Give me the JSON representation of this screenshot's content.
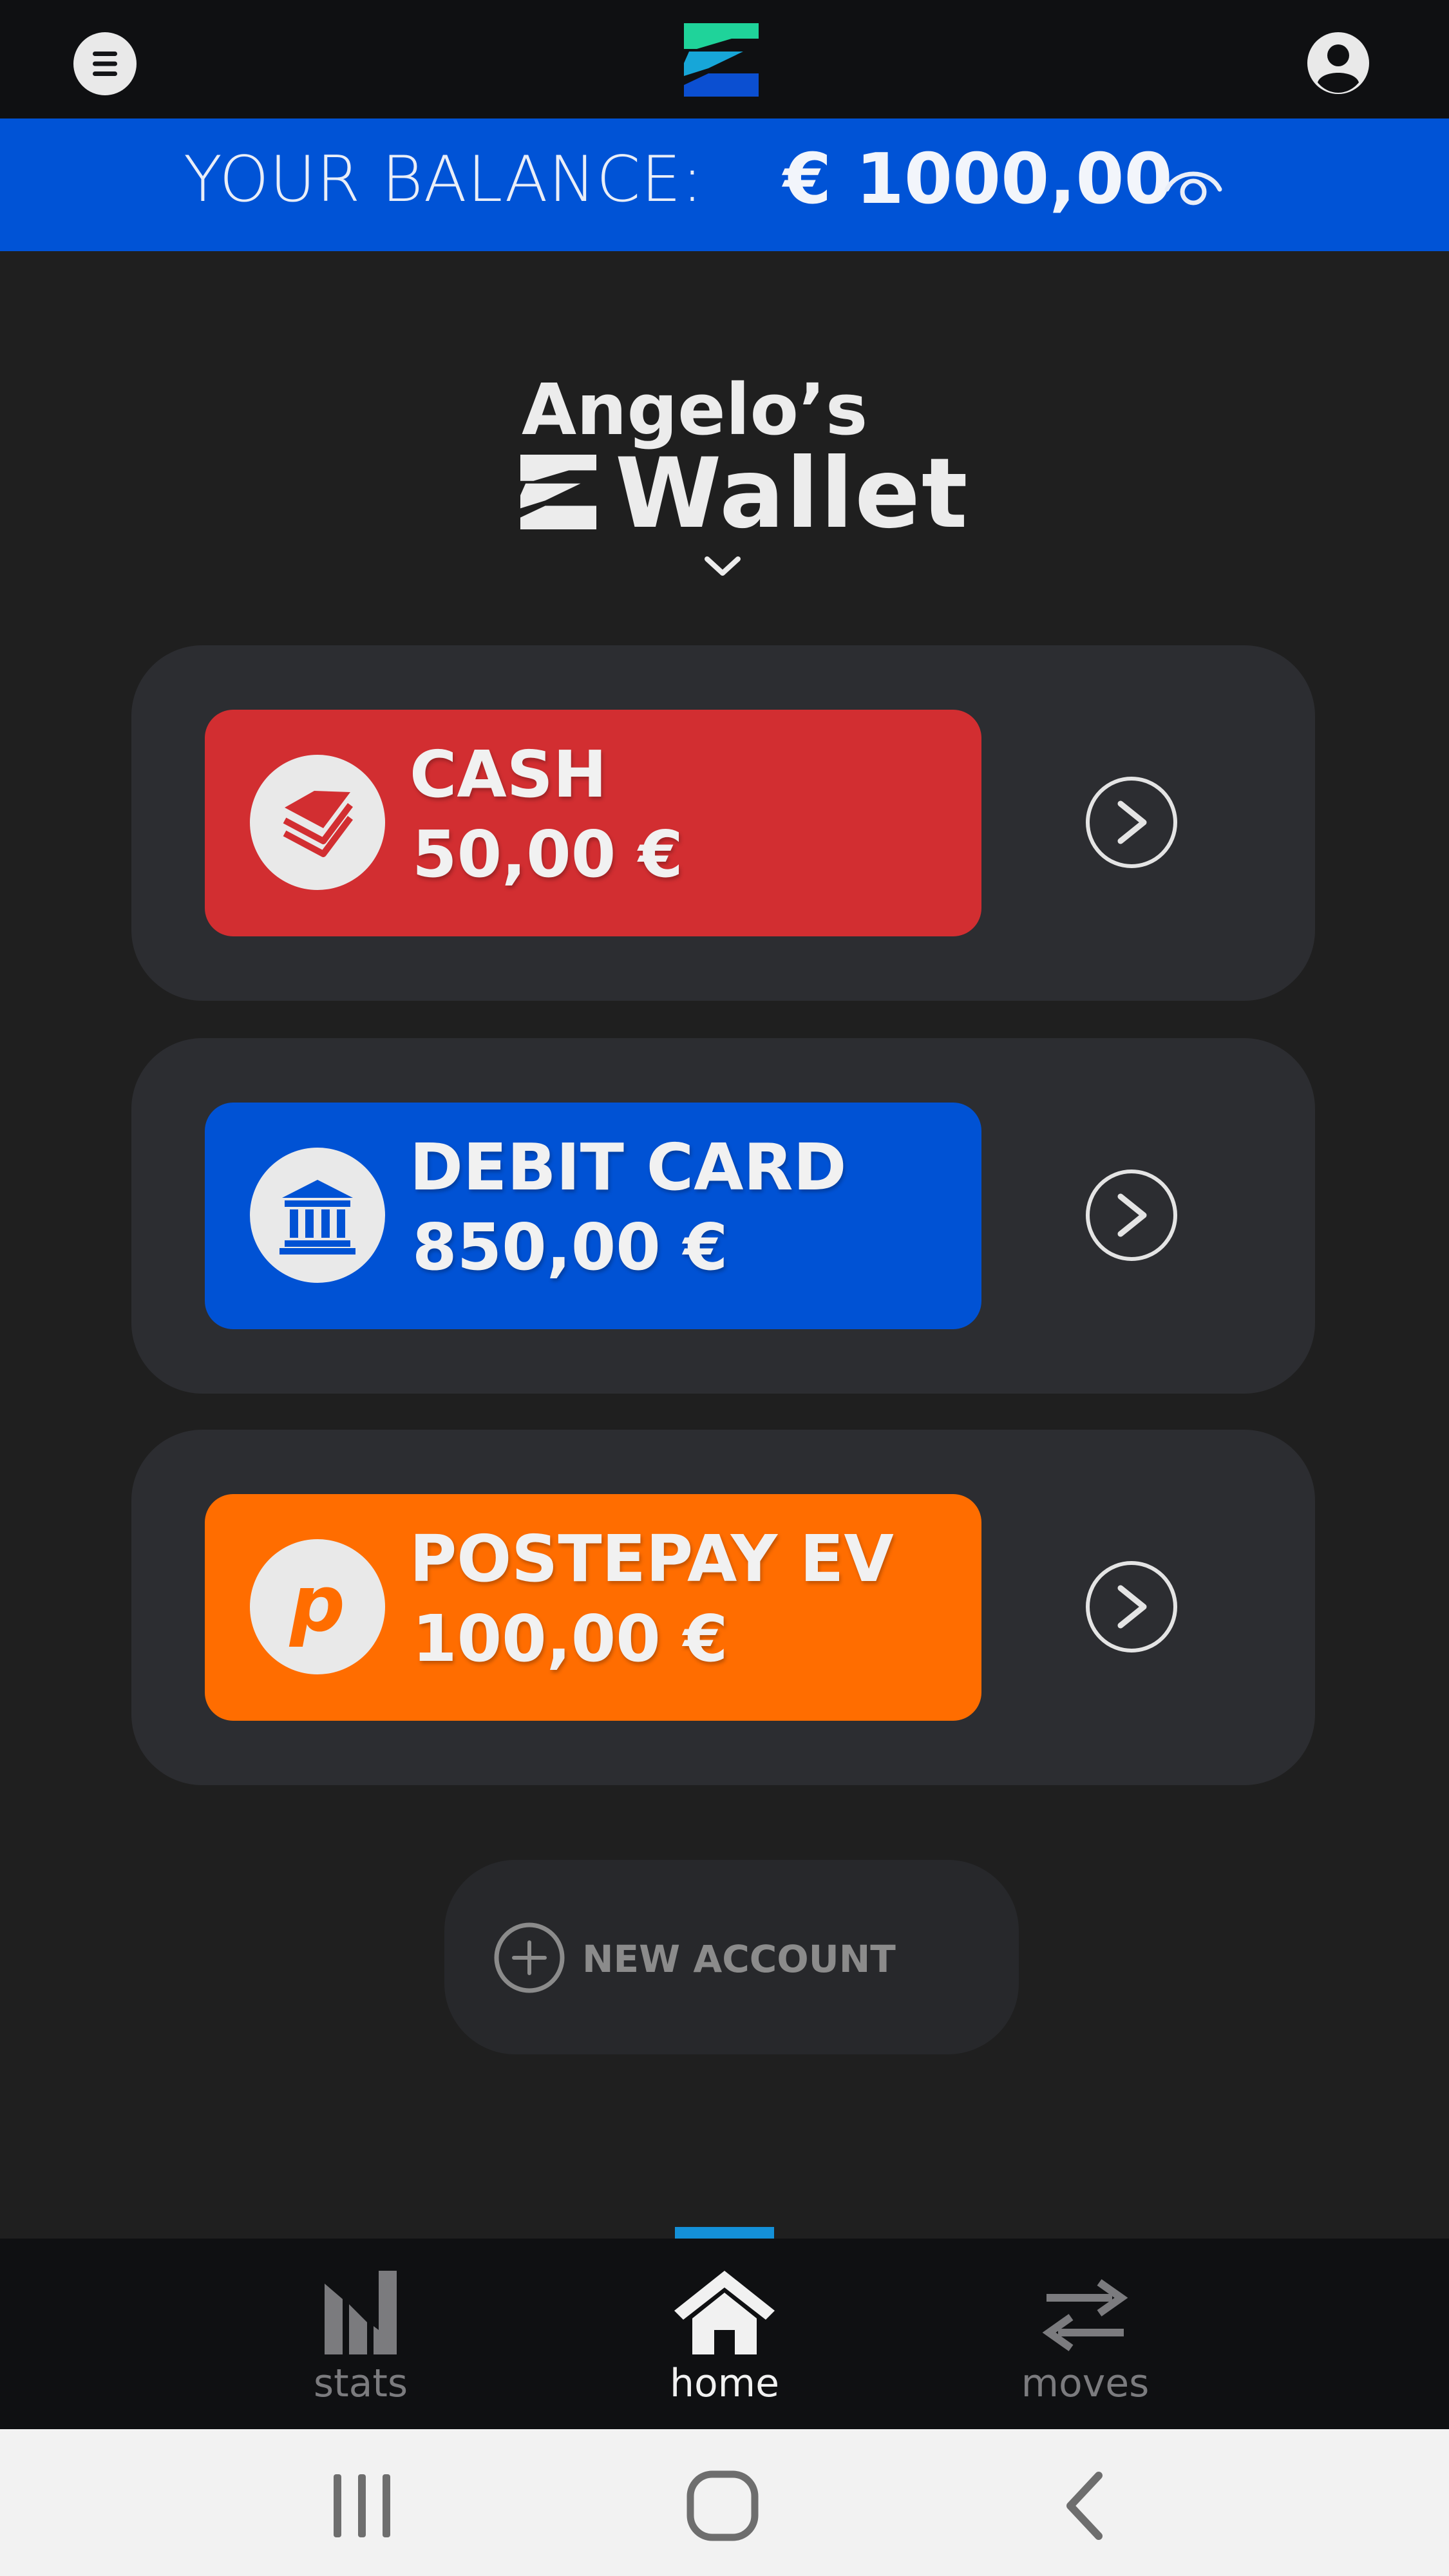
{
  "header": {
    "menu_icon": "hamburger-menu-icon",
    "logo_icon": "app-logo-z",
    "profile_icon": "user-profile-icon"
  },
  "balance": {
    "label": "YOUR BALANCE:",
    "value": "€ 1000,00",
    "toggle_icon": "eye-icon"
  },
  "wallet": {
    "owner": "Angelo’s",
    "name": "Wallet",
    "selector_icon": "chevron-down-icon"
  },
  "accounts": [
    {
      "name": "CASH",
      "amount": "50,00 €",
      "icon": "cash-stack-icon",
      "color": "#d22e31"
    },
    {
      "name": "DEBIT CARD",
      "amount": "850,00 €",
      "icon": "bank-icon",
      "color": "#0052d4"
    },
    {
      "name": "POSTEPAY EV",
      "amount": "100,00 €",
      "icon": "postepay-p-icon",
      "color": "#ff6d00"
    }
  ],
  "new_account": {
    "label": "NEW ACCOUNT",
    "icon": "plus-circle-icon"
  },
  "nav": {
    "active": "home",
    "items": [
      {
        "label": "stats",
        "icon": "stats-icon"
      },
      {
        "label": "home",
        "icon": "home-icon"
      },
      {
        "label": "moves",
        "icon": "transfer-arrows-icon"
      }
    ]
  },
  "system_nav": {
    "recents_icon": "recents-icon",
    "home_icon": "system-home-icon",
    "back_icon": "back-icon"
  },
  "colors": {
    "accent_blue": "#0053d6",
    "indicator": "#1490d8",
    "background": "#1f1f1f",
    "panel": "#2c2d31",
    "logo_green": "#1fd39a",
    "logo_cyan": "#17a6d8",
    "logo_blue": "#0b4fd1"
  }
}
